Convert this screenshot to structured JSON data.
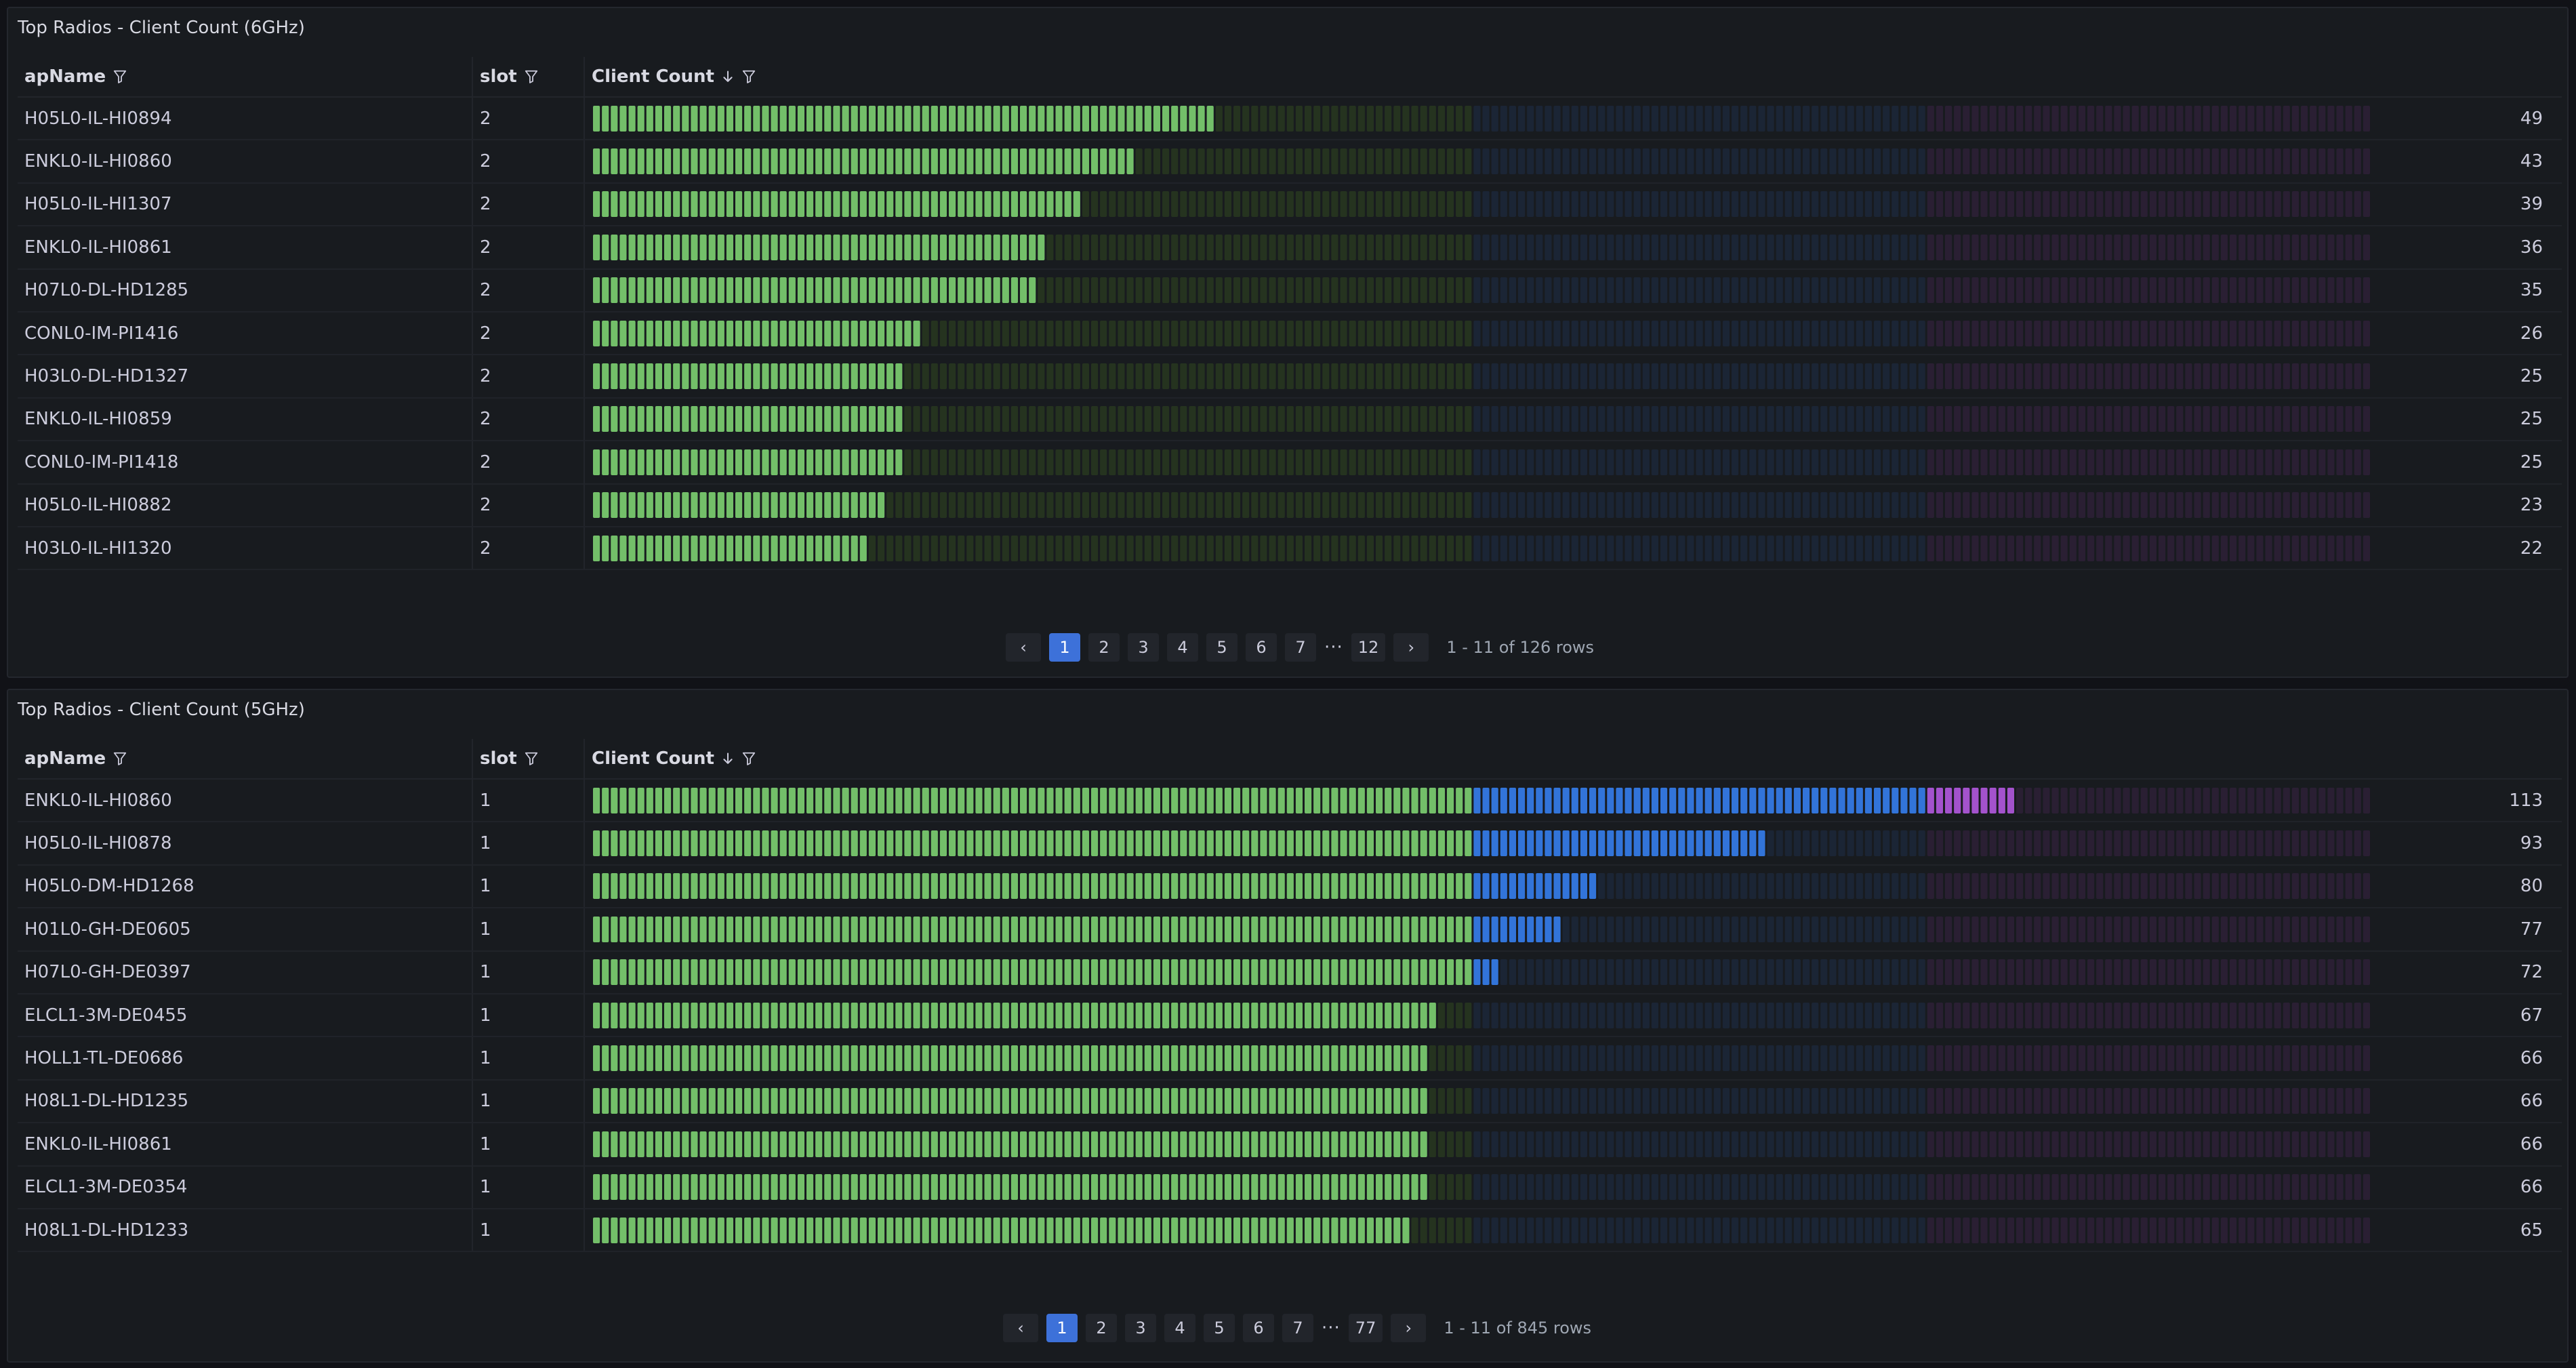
{
  "colors": {
    "green_on": "#73bf69",
    "green_off": "#25331f",
    "blue_on": "#3274d9",
    "blue_off": "#1b2535",
    "purple_on": "#a352cc",
    "purple_off": "#2a1f33",
    "active_page": "#3d71d9"
  },
  "columns": {
    "ap_name": "apName",
    "slot": "slot",
    "client_count": "Client Count"
  },
  "panels": [
    {
      "title": "Top Radios - Client Count (6GHz)",
      "gauge_max": 126,
      "thresholds": [
        70,
        106,
        141
      ],
      "rows": [
        {
          "ap": "H05L0-IL-HI0894",
          "slot": "2",
          "count": 49
        },
        {
          "ap": "ENKL0-IL-HI0860",
          "slot": "2",
          "count": 43
        },
        {
          "ap": "H05L0-IL-HI1307",
          "slot": "2",
          "count": 39
        },
        {
          "ap": "ENKL0-IL-HI0861",
          "slot": "2",
          "count": 36
        },
        {
          "ap": "H07L0-DL-HD1285",
          "slot": "2",
          "count": 35
        },
        {
          "ap": "CONL0-IM-PI1416",
          "slot": "2",
          "count": 26
        },
        {
          "ap": "H03L0-DL-HD1327",
          "slot": "2",
          "count": 25
        },
        {
          "ap": "ENKL0-IL-HI0859",
          "slot": "2",
          "count": 25
        },
        {
          "ap": "CONL0-IM-PI1418",
          "slot": "2",
          "count": 25
        },
        {
          "ap": "H05L0-IL-HI0882",
          "slot": "2",
          "count": 23
        },
        {
          "ap": "H03L0-IL-HI1320",
          "slot": "2",
          "count": 22
        }
      ],
      "pagination": {
        "prev": "‹",
        "next": "›",
        "pages": [
          "1",
          "2",
          "3",
          "4",
          "5",
          "6",
          "7"
        ],
        "ellipsis": "···",
        "last": "12",
        "summary": "1 - 11 of 126 rows"
      }
    },
    {
      "title": "Top Radios - Client Count (5GHz)",
      "gauge_max": 126,
      "thresholds": [
        70,
        106,
        141
      ],
      "rows": [
        {
          "ap": "ENKL0-IL-HI0860",
          "slot": "1",
          "count": 113
        },
        {
          "ap": "H05L0-IL-HI0878",
          "slot": "1",
          "count": 93
        },
        {
          "ap": "H05L0-DM-HD1268",
          "slot": "1",
          "count": 80
        },
        {
          "ap": "H01L0-GH-DE0605",
          "slot": "1",
          "count": 77
        },
        {
          "ap": "H07L0-GH-DE0397",
          "slot": "1",
          "count": 72
        },
        {
          "ap": "ELCL1-3M-DE0455",
          "slot": "1",
          "count": 67
        },
        {
          "ap": "HOLL1-TL-DE0686",
          "slot": "1",
          "count": 66
        },
        {
          "ap": "H08L1-DL-HD1235",
          "slot": "1",
          "count": 66
        },
        {
          "ap": "ENKL0-IL-HI0861",
          "slot": "1",
          "count": 66
        },
        {
          "ap": "ELCL1-3M-DE0354",
          "slot": "1",
          "count": 66
        },
        {
          "ap": "H08L1-DL-HD1233",
          "slot": "1",
          "count": 65
        }
      ],
      "pagination": {
        "prev": "‹",
        "next": "›",
        "pages": [
          "1",
          "2",
          "3",
          "4",
          "5",
          "6",
          "7"
        ],
        "ellipsis": "···",
        "last": "77",
        "summary": "1 - 11 of 845 rows"
      }
    }
  ]
}
